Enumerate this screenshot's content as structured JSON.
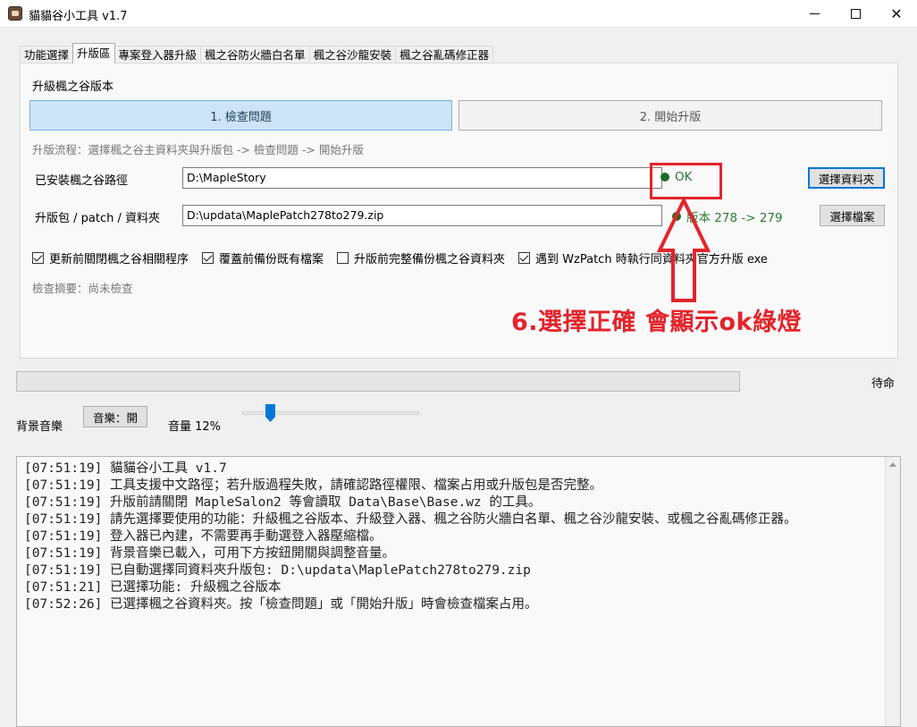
{
  "window": {
    "title": "貓貓谷小工具 v1.7",
    "minimize": "minimize",
    "maximize": "maximize",
    "close": "✕"
  },
  "tabs": [
    "功能選擇",
    "升版區",
    "專案登入器升級",
    "楓之谷防火牆白名單",
    "楓之谷沙龍安裝",
    "楓之谷亂碼修正器"
  ],
  "active_tab": "升版區",
  "panel": {
    "title": "升級楓之谷版本",
    "step1_label": "1. 檢查問題",
    "step2_label": "2. 開始升版",
    "flow_text": "升版流程：選擇楓之谷主資料夾與升版包 -> 檢查問題 -> 開始升版",
    "install_path_label": "已安裝楓之谷路徑",
    "install_path_value": "D:\\MapleStory",
    "install_status": "OK",
    "choose_folder_label": "選擇資料夾",
    "patch_label": "升版包 / patch / 資料夾",
    "patch_value": "D:\\updata\\MaplePatch278to279.zip",
    "patch_status": "版本 278 -> 279",
    "choose_file_label": "選擇檔案",
    "options": [
      {
        "label": "更新前關閉楓之谷相關程序",
        "checked": true
      },
      {
        "label": "覆蓋前備份既有檔案",
        "checked": true
      },
      {
        "label": "升版前完整備份楓之谷資料夾",
        "checked": false
      },
      {
        "label": "遇到 WzPatch 時執行同資料夾官方升版 exe",
        "checked": true
      }
    ],
    "summary": "檢查摘要：尚未檢查"
  },
  "annotation": {
    "text": "6.選擇正確 會顯示ok綠燈",
    "color": "#e3242b"
  },
  "progress": {
    "value": 0,
    "status_text": "待命"
  },
  "music": {
    "label": "背景音樂",
    "button_label": "音樂：開",
    "volume_label": "音量 12%",
    "volume_value": 0.12
  },
  "log": [
    "[07:51:19] 貓貓谷小工具 v1.7",
    "[07:51:19] 工具支援中文路徑；若升版過程失敗，請確認路徑權限、檔案占用或升版包是否完整。",
    "[07:51:19] 升版前請關閉 MapleSalon2 等會讀取 Data\\Base\\Base.wz 的工具。",
    "[07:51:19] 請先選擇要使用的功能：升級楓之谷版本、升級登入器、楓之谷防火牆白名單、楓之谷沙龍安裝、或楓之谷亂碼修正器。",
    "[07:51:19] 登入器已內建，不需要再手動選登入器壓縮檔。",
    "[07:51:19] 背景音樂已載入，可用下方按鈕開關與調整音量。",
    "[07:51:19] 已自動選擇同資料夾升版包: D:\\updata\\MaplePatch278to279.zip",
    "[07:51:21] 已選擇功能: 升級楓之谷版本",
    "[07:52:26] 已選擇楓之谷資料夾。按「檢查問題」或「開始升版」時會檢查檔案占用。"
  ]
}
